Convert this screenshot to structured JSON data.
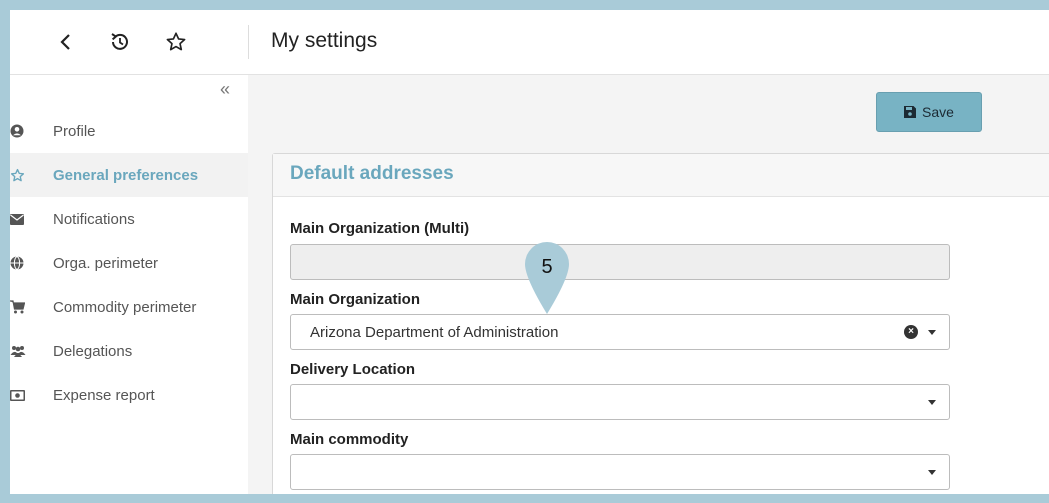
{
  "header": {
    "title": "My settings",
    "back_icon": "chevron-left-icon",
    "history_icon": "history-icon",
    "favorite_icon": "star-outline-icon"
  },
  "sidebar": {
    "collapse_label": "«",
    "items": [
      {
        "label": "Profile",
        "icon": "user-circle-icon",
        "active": false
      },
      {
        "label": "General preferences",
        "icon": "star-outline-icon",
        "active": true
      },
      {
        "label": "Notifications",
        "icon": "envelope-icon",
        "active": false
      },
      {
        "label": "Orga. perimeter",
        "icon": "globe-icon",
        "active": false
      },
      {
        "label": "Commodity perimeter",
        "icon": "cart-icon",
        "active": false
      },
      {
        "label": "Delegations",
        "icon": "users-icon",
        "active": false
      },
      {
        "label": "Expense report",
        "icon": "money-icon",
        "active": false
      }
    ]
  },
  "toolbar": {
    "save_label": "Save",
    "save_icon": "floppy-disk-icon"
  },
  "panel": {
    "title": "Default addresses",
    "fields": [
      {
        "label": "Main Organization (Multi)",
        "value": "",
        "disabled": true
      },
      {
        "label": "Main Organization",
        "value": "Arizona Department of Administration",
        "clearable": true
      },
      {
        "label": "Delivery Location",
        "value": ""
      },
      {
        "label": "Main commodity",
        "value": ""
      }
    ]
  },
  "callout": {
    "step": "5"
  },
  "colors": {
    "accent": "#6aa7bd",
    "save_button": "#78b3c4",
    "frame": "#a9cbd8"
  }
}
